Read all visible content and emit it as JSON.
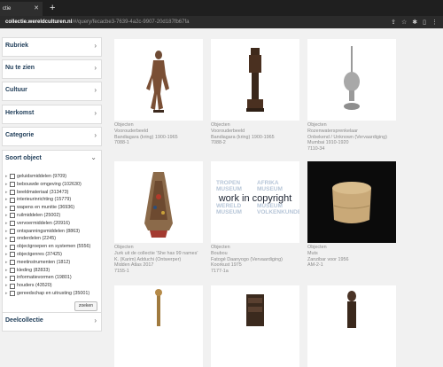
{
  "browser": {
    "tab_title": "ctie",
    "url_host": "collectie.wereldculturen.nl",
    "url_path": "/#/query/fecacbe3-7639-4a2c-9907-20d187fb67fa"
  },
  "sidebar": {
    "facets_top": [
      "Rubriek",
      "Nu te zien",
      "Cultuur",
      "Herkomst",
      "Categorie"
    ],
    "soort": {
      "title": "Soort object",
      "items": [
        "geluidsmiddelen (9709)",
        "bebouwde omgeving (102630)",
        "beeldmateriaal (313473)",
        "interieurinrichting (15779)",
        "wapens en munitie (36936)",
        "ruilmiddelen (25002)",
        "vervoermiddelen (20916)",
        "ontspanningsmiddelen (8863)",
        "onderdelen (2245)",
        "objectgroepen en systemen (5556)",
        "objectgenres (37425)",
        "meetinstrumenten (1812)",
        "kleding (82833)",
        "informatievormen (19801)",
        "houders (43520)",
        "gereedschap en uitrusting (35001)"
      ],
      "button": "zoeken"
    },
    "deelcollectie": "Deelcollectie"
  },
  "cards": [
    {
      "lines": [
        "Objecten",
        "Voorouderbeeld",
        "Bandiagara (kring) 1900-1965",
        "7088-1"
      ]
    },
    {
      "lines": [
        "Objecten",
        "Voorouderbeeld",
        "Bandiagara (kring) 1900-1965",
        "7088-2"
      ]
    },
    {
      "lines": [
        "Objecten",
        "Rozenwatersprenkelaar",
        "Onbekend / Unknown (Vervaardiging)",
        "Mumbai 1910-1920",
        "7110-34"
      ]
    },
    {
      "lines": [
        "Objecten",
        "Jurk uit de collectie 'She has 99 names'",
        "K. (Karim) Adduchi (Ontwerper)",
        "Midden Atlas 2017",
        "7155-1"
      ]
    },
    {
      "lines": [
        "Objecten",
        "Boubou",
        "Fatogé Daanyogo (Vervaardiging)",
        "Koorkust 1975",
        "7177-1a"
      ]
    },
    {
      "lines": [
        "Objecten",
        "Muts",
        "Zanzibar voor 1956",
        "AM-2-1"
      ]
    }
  ],
  "copyright_tile": {
    "logo_words": [
      "TROPEN",
      "MUSEUM",
      "WERELD",
      "MUSEUM",
      "AFRIKA",
      "MUSEUM",
      "MUSEUM",
      "VOLKENKUNDE"
    ],
    "overlay": "work in copyright"
  }
}
